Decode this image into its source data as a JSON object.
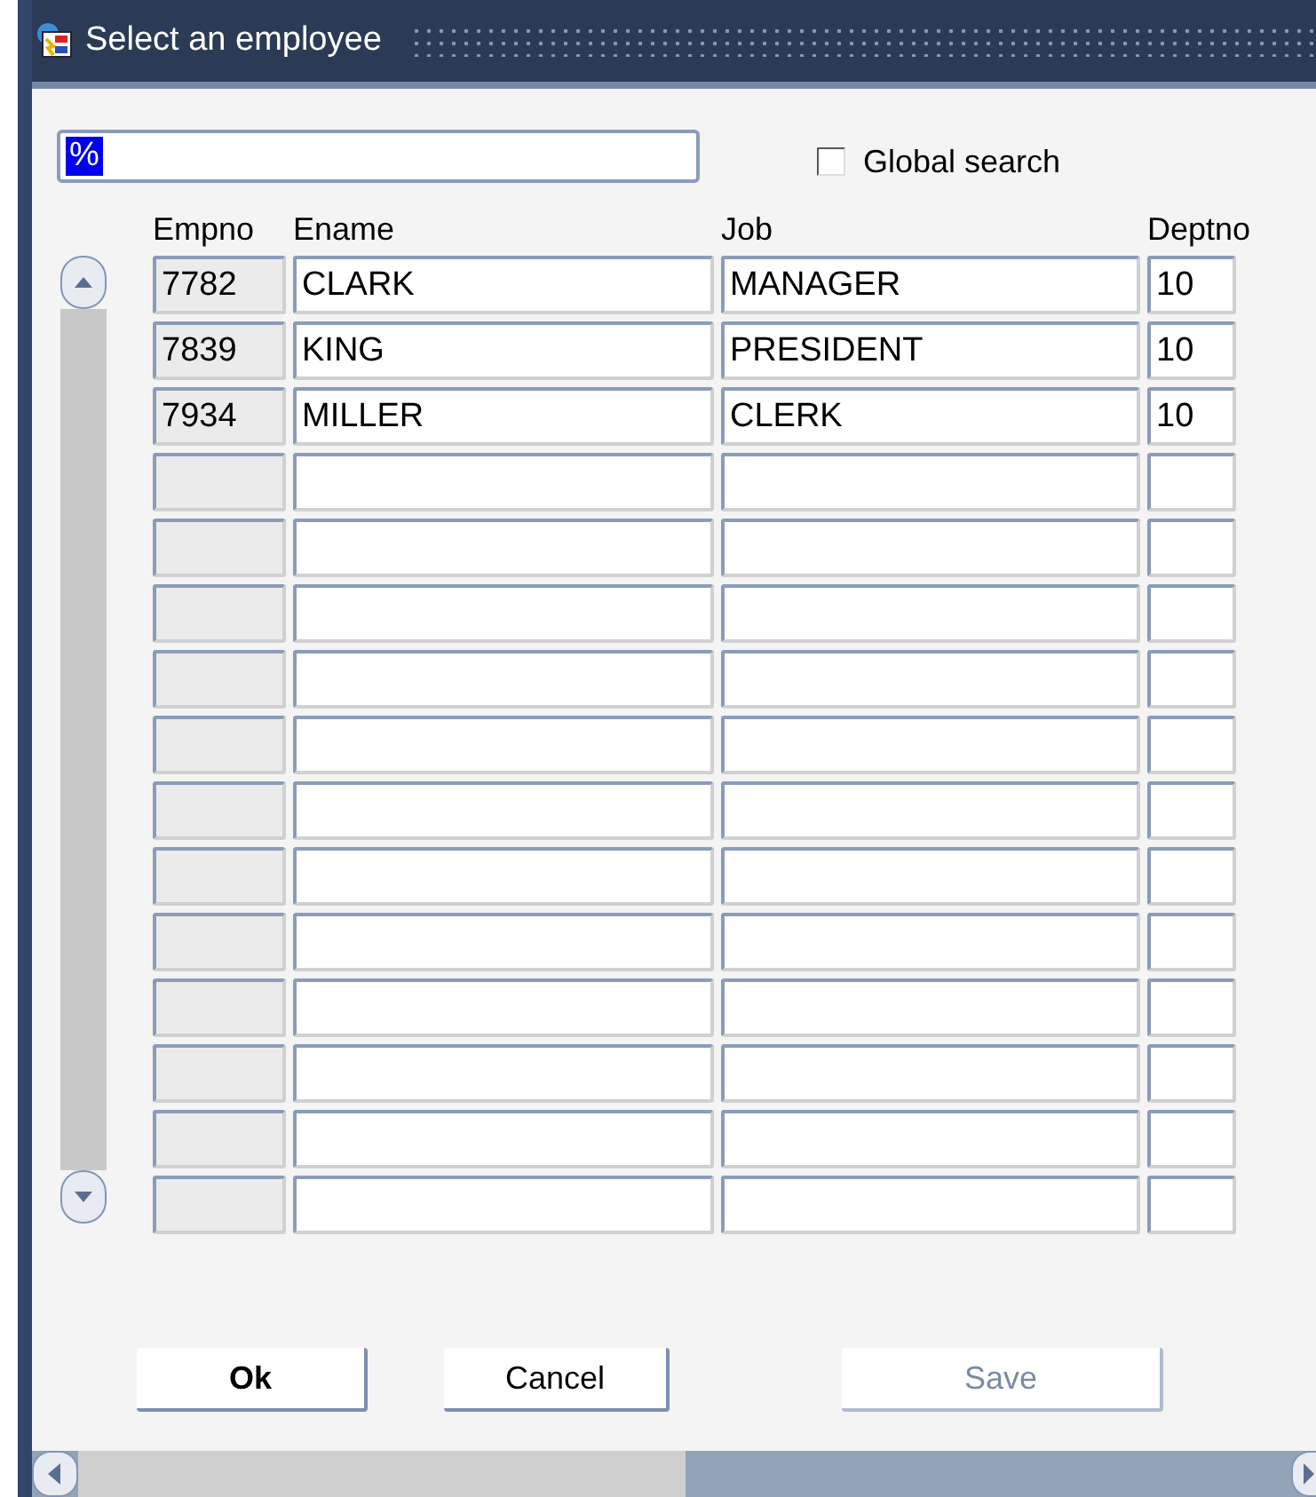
{
  "window": {
    "title": "Select an employee"
  },
  "search": {
    "value": "%",
    "highlighted": true
  },
  "global_search": {
    "label": "Global search",
    "checked": false
  },
  "table": {
    "columns": [
      "Empno",
      "Ename",
      "Job",
      "Deptno"
    ],
    "rows": [
      {
        "empno": "7782",
        "ename": "CLARK",
        "job": "MANAGER",
        "deptno": "10"
      },
      {
        "empno": "7839",
        "ename": "KING",
        "job": "PRESIDENT",
        "deptno": "10"
      },
      {
        "empno": "7934",
        "ename": "MILLER",
        "job": "CLERK",
        "deptno": "10"
      },
      {},
      {},
      {},
      {},
      {},
      {},
      {},
      {},
      {},
      {},
      {},
      {}
    ]
  },
  "buttons": [
    {
      "label": "Ok",
      "default": true,
      "disabled": false
    },
    {
      "label": "Cancel",
      "default": false,
      "disabled": false
    },
    {
      "label": "Save",
      "default": false,
      "disabled": true
    }
  ]
}
